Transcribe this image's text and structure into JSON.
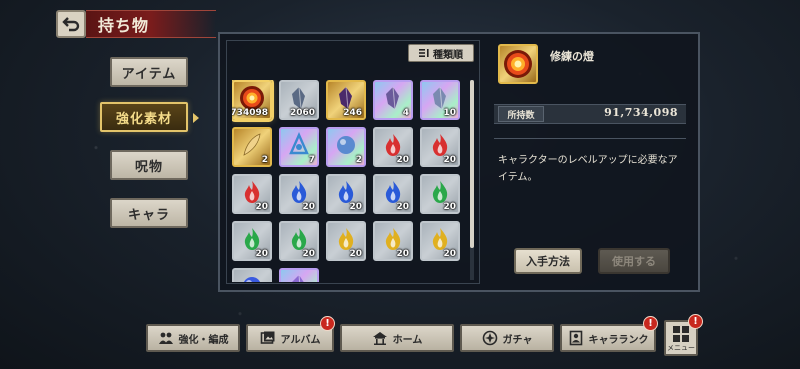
{
  "header": {
    "title": "持ち物"
  },
  "categories": [
    {
      "label": "アイテム",
      "active": false
    },
    {
      "label": "強化素材",
      "active": true
    },
    {
      "label": "呪物",
      "active": false
    },
    {
      "label": "キャラ",
      "active": false
    }
  ],
  "sort": {
    "label": "種類順"
  },
  "items": [
    {
      "icon": "flame-orb-icon",
      "qty": "91734098",
      "rarity": "gold",
      "color": "#e84a1a"
    },
    {
      "icon": "grey-crystal-icon",
      "qty": "2060",
      "rarity": "silver",
      "color": "#5a6a84"
    },
    {
      "icon": "dark-crystal-icon",
      "qty": "246",
      "rarity": "gold",
      "color": "#4a2a6a"
    },
    {
      "icon": "winged-crystal-icon",
      "qty": "4",
      "rarity": "holo",
      "color": "#6a5a9a"
    },
    {
      "icon": "shard-icon",
      "qty": "10",
      "rarity": "holo",
      "color": "#7a8ab0"
    },
    {
      "icon": "golden-feather-icon",
      "qty": "2",
      "rarity": "gold",
      "color": "#f0d28a"
    },
    {
      "icon": "blue-rune-icon",
      "qty": "7",
      "rarity": "holo",
      "color": "#3a8ad0"
    },
    {
      "icon": "pedestal-orb-icon",
      "qty": "2",
      "rarity": "holo",
      "color": "#5a8ad0"
    },
    {
      "icon": "red-spirit-flame-icon",
      "qty": "20",
      "rarity": "silver",
      "color": "#d83030"
    },
    {
      "icon": "red-spirit-flame-icon",
      "qty": "20",
      "rarity": "silver",
      "color": "#d83030"
    },
    {
      "icon": "red-spirit-flame-icon",
      "qty": "20",
      "rarity": "silver",
      "color": "#d83030"
    },
    {
      "icon": "blue-spirit-flame-icon",
      "qty": "20",
      "rarity": "silver",
      "color": "#2a5ad8"
    },
    {
      "icon": "blue-spirit-flame-icon",
      "qty": "20",
      "rarity": "silver",
      "color": "#2a5ad8"
    },
    {
      "icon": "blue-spirit-flame-icon",
      "qty": "20",
      "rarity": "silver",
      "color": "#2a5ad8"
    },
    {
      "icon": "green-spirit-flame-icon",
      "qty": "20",
      "rarity": "silver",
      "color": "#2aa84a"
    },
    {
      "icon": "green-spirit-flame-icon",
      "qty": "20",
      "rarity": "silver",
      "color": "#2aa84a"
    },
    {
      "icon": "green-spirit-flame-icon",
      "qty": "20",
      "rarity": "silver",
      "color": "#2aa84a"
    },
    {
      "icon": "yellow-spirit-flame-icon",
      "qty": "20",
      "rarity": "silver",
      "color": "#e0b020"
    },
    {
      "icon": "yellow-spirit-flame-icon",
      "qty": "20",
      "rarity": "silver",
      "color": "#e0b020"
    },
    {
      "icon": "yellow-spirit-flame-icon",
      "qty": "20",
      "rarity": "silver",
      "color": "#e0b020"
    },
    {
      "icon": "blue-orb-icon",
      "qty": "",
      "rarity": "silver",
      "color": "#3a5ae0"
    },
    {
      "icon": "holo-item-icon",
      "qty": "",
      "rarity": "holo",
      "color": "#8a6ad0"
    }
  ],
  "detail": {
    "name": "修練の燈",
    "owned_label": "所持数",
    "owned_value": "91,734,098",
    "description": "キャラクターのレベルアップに必要なアイテム。",
    "acquire_label": "入手方法",
    "use_label": "使用する"
  },
  "nav": [
    {
      "label": "強化・編成",
      "icon": "people-icon",
      "badge": ""
    },
    {
      "label": "アルバム",
      "icon": "album-icon",
      "badge": "!"
    },
    {
      "label": "ホーム",
      "icon": "home-icon",
      "badge": ""
    },
    {
      "label": "ガチャ",
      "icon": "gacha-icon",
      "badge": ""
    },
    {
      "label": "キャラランク",
      "icon": "character-rank-icon",
      "badge": "!"
    }
  ],
  "menu": {
    "label": "メニュー",
    "badge": "!"
  },
  "colors": {
    "accent_gold": "#e3c46a",
    "title_red": "#7a1c1c",
    "badge_red": "#c8281e"
  }
}
